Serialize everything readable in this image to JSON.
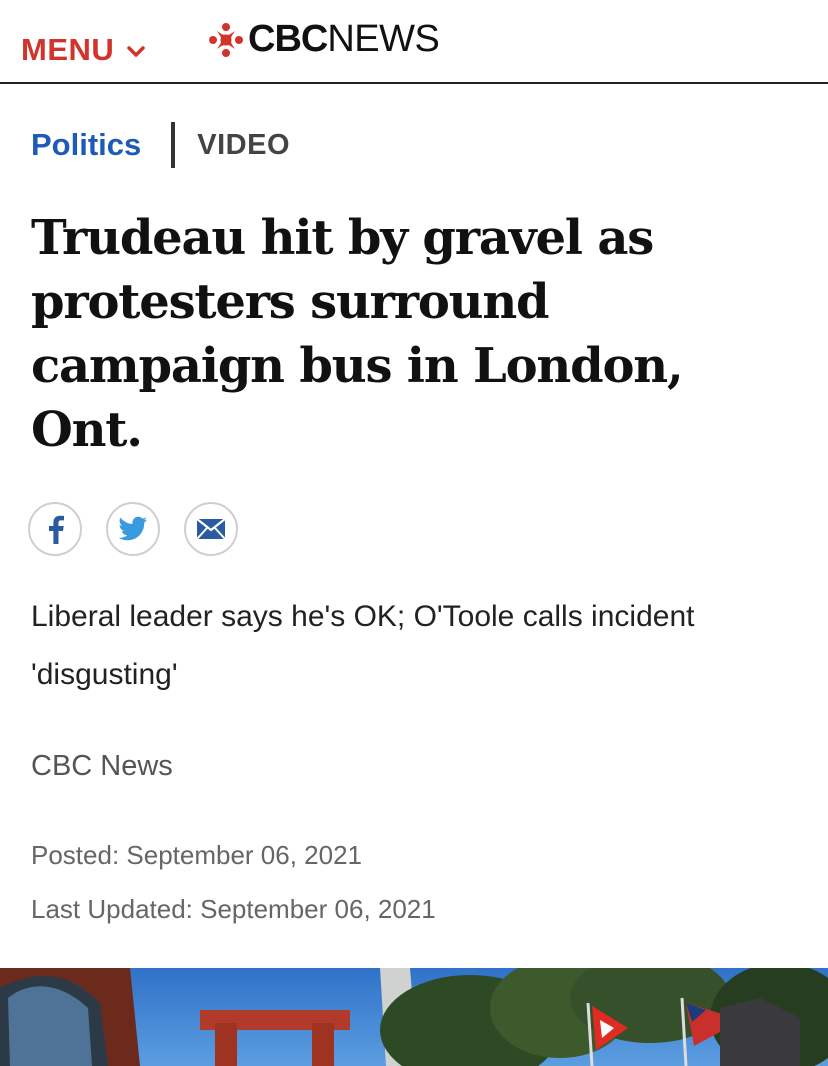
{
  "header": {
    "menu_label": "MENU",
    "logo_cbc": "CBC",
    "logo_news": "NEWS",
    "brand_color": "#d0342c"
  },
  "breadcrumb": {
    "section": "Politics",
    "type": "VIDEO"
  },
  "article": {
    "headline": "Trudeau hit by gravel as protesters surround campaign bus in London, Ont.",
    "deck": "Liberal leader says he's OK; O'Toole calls incident 'disgusting'",
    "byline": "CBC News",
    "posted": "Posted: September 06, 2021",
    "updated": "Last Updated: September 06, 2021"
  },
  "share": {
    "icons": [
      "facebook-icon",
      "twitter-icon",
      "email-icon"
    ]
  },
  "colors": {
    "link": "#1e5bb8",
    "text": "#111111",
    "muted": "#666666"
  }
}
